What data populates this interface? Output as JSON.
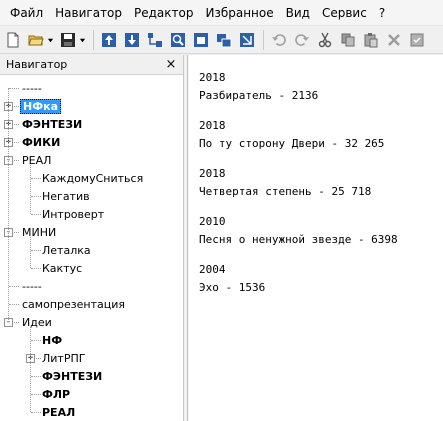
{
  "menubar": {
    "items": [
      "Файл",
      "Навигатор",
      "Редактор",
      "Избранное",
      "Вид",
      "Сервис",
      "?"
    ]
  },
  "toolbar": {
    "buttons": [
      {
        "name": "new-document-icon"
      },
      {
        "name": "open-folder-icon"
      },
      {
        "name": "save-icon"
      },
      {
        "name": "move-up-icon"
      },
      {
        "name": "move-down-icon"
      },
      {
        "name": "add-child-icon"
      },
      {
        "name": "find-icon"
      },
      {
        "name": "window-icon"
      },
      {
        "name": "tile-windows-icon"
      },
      {
        "name": "collapse-icon"
      },
      {
        "name": "undo-icon"
      },
      {
        "name": "redo-icon"
      },
      {
        "name": "cut-icon"
      },
      {
        "name": "copy-icon"
      },
      {
        "name": "paste-icon"
      },
      {
        "name": "delete-icon"
      },
      {
        "name": "properties-icon"
      }
    ]
  },
  "navigator": {
    "title": "Навигатор",
    "close_glyph": "×",
    "tree": [
      {
        "label": "-----",
        "depth": 0,
        "expander": null,
        "bold": false,
        "selected": false
      },
      {
        "label": "НФка",
        "depth": 0,
        "expander": "+",
        "bold": true,
        "selected": true
      },
      {
        "label": "ФЭНТЕЗИ",
        "depth": 0,
        "expander": "+",
        "bold": true,
        "selected": false
      },
      {
        "label": "ФИКИ",
        "depth": 0,
        "expander": "+",
        "bold": true,
        "selected": false
      },
      {
        "label": "РЕАЛ",
        "depth": 0,
        "expander": "-",
        "bold": false,
        "selected": false
      },
      {
        "label": "КаждомуСниться",
        "depth": 1,
        "expander": null,
        "bold": false,
        "selected": false
      },
      {
        "label": "Негатив",
        "depth": 1,
        "expander": null,
        "bold": false,
        "selected": false
      },
      {
        "label": "Интроверт",
        "depth": 1,
        "expander": null,
        "bold": false,
        "selected": false
      },
      {
        "label": "МИНИ",
        "depth": 0,
        "expander": "-",
        "bold": false,
        "selected": false
      },
      {
        "label": "Леталка",
        "depth": 1,
        "expander": null,
        "bold": false,
        "selected": false
      },
      {
        "label": "Кактус",
        "depth": 1,
        "expander": null,
        "bold": false,
        "selected": false
      },
      {
        "label": "-----",
        "depth": 0,
        "expander": null,
        "bold": false,
        "selected": false
      },
      {
        "label": "самопрезентация",
        "depth": 0,
        "expander": null,
        "bold": false,
        "selected": false
      },
      {
        "label": "Идеи",
        "depth": 0,
        "expander": "-",
        "bold": false,
        "selected": false
      },
      {
        "label": "НФ",
        "depth": 1,
        "expander": null,
        "bold": true,
        "selected": false
      },
      {
        "label": "ЛитРПГ",
        "depth": 1,
        "expander": "+",
        "bold": false,
        "selected": false
      },
      {
        "label": "ФЭНТЕЗИ",
        "depth": 1,
        "expander": null,
        "bold": true,
        "selected": false
      },
      {
        "label": "ФЛР",
        "depth": 1,
        "expander": null,
        "bold": true,
        "selected": false
      },
      {
        "label": "РЕАЛ",
        "depth": 1,
        "expander": null,
        "bold": true,
        "selected": false
      }
    ]
  },
  "editor": {
    "entries": [
      {
        "year": "2018",
        "text": "Разбиратель - 2136"
      },
      {
        "year": "2018",
        "text": "По ту сторону Двери - 32 265"
      },
      {
        "year": "2018",
        "text": "Четвертая степень - 25 718"
      },
      {
        "year": "2010",
        "text": "Песня о ненужной звезде - 6398"
      },
      {
        "year": "2004",
        "text": "Эхо - 1536"
      }
    ]
  },
  "colors": {
    "selection": "#3399ff",
    "toolbar_blue": "#2c5fa8"
  }
}
